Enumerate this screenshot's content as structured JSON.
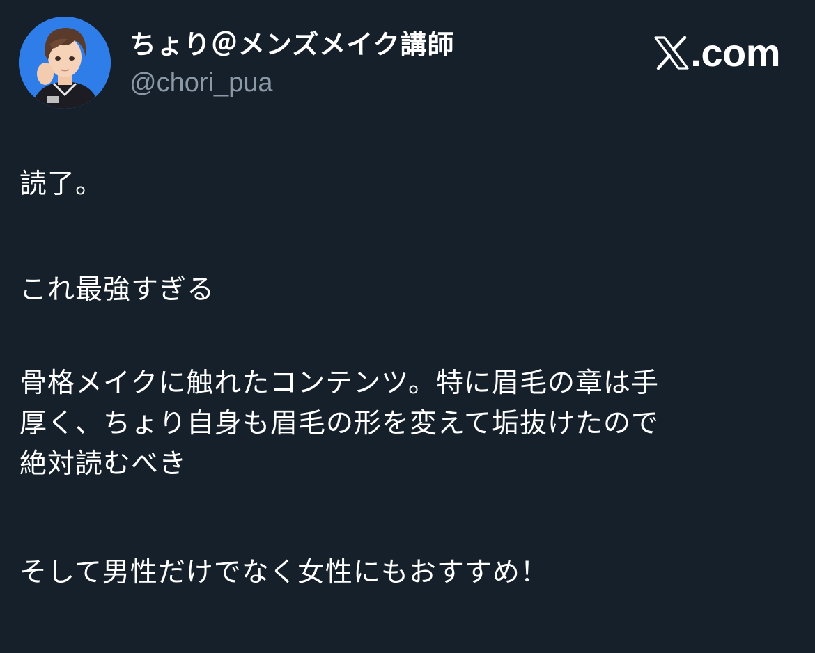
{
  "author": {
    "display_name": "ちょり＠メンズメイク講師",
    "handle": "@chori_pua"
  },
  "brand": {
    "icon": "x-logo-icon",
    "suffix": ".com"
  },
  "tweet": {
    "paragraphs": [
      "読了。",
      "これ最強すぎる",
      "骨格メイクに触れたコンテンツ。特に眉毛の章は手\n厚く、ちょり自身も眉毛の形を変えて垢抜けたので\n絶対読むべき",
      "そして男性だけでなく女性にもおすすめ！"
    ]
  },
  "colors": {
    "background": "#15202b",
    "text": "#ffffff",
    "secondary_text": "#8b98a5",
    "avatar_bg": "#2f7de8"
  }
}
